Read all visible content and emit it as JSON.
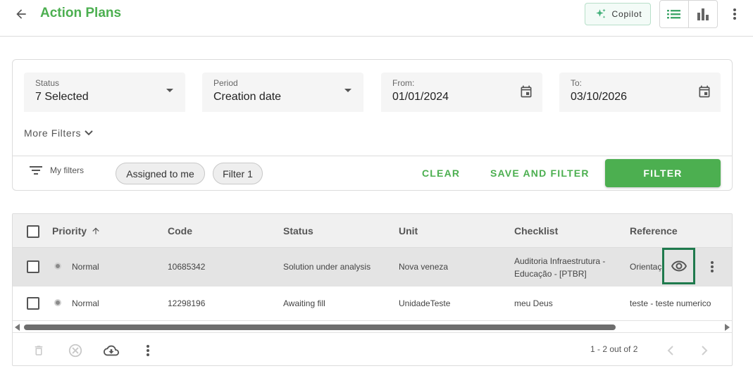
{
  "header": {
    "title": "Action Plans",
    "copilot_label": "Copilot"
  },
  "filters": {
    "status": {
      "label": "Status",
      "value": "7 Selected"
    },
    "period": {
      "label": "Period",
      "value": "Creation date"
    },
    "from": {
      "label": "From:",
      "value": "01/01/2024"
    },
    "to": {
      "label": "To:",
      "value": "03/10/2026"
    },
    "more_filters": "More Filters",
    "my_filters": "My filters",
    "chips": [
      "Assigned to me",
      "Filter 1"
    ],
    "clear_label": "CLEAR",
    "save_and_filter_label": "SAVE AND FILTER",
    "filter_label": "FILTER"
  },
  "table": {
    "columns": [
      "Priority",
      "Code",
      "Status",
      "Unit",
      "Checklist",
      "Reference"
    ],
    "rows": [
      {
        "priority": "Normal",
        "code": "10685342",
        "status": "Solution under analysis",
        "unit": "Nova veneza",
        "checklist_line1": "Auditoria Infraestrutura -",
        "checklist_line2": "Educação - [PTBR]",
        "reference": "Orientaç"
      },
      {
        "priority": "Normal",
        "code": "12298196",
        "status": "Awaiting fill",
        "unit": "UnidadeTeste",
        "checklist_line1": "meu Deus",
        "checklist_line2": "",
        "reference": "teste - teste numerico"
      }
    ],
    "pagination": "1 - 2 out of 2"
  },
  "colors": {
    "accent": "#4caf50",
    "highlight_border": "#1f7a4d"
  },
  "icons": [
    "back-arrow-icon",
    "sparkle-icon",
    "list-view-icon",
    "bar-chart-icon",
    "more-vert-icon",
    "chevron-down-icon",
    "calendar-icon",
    "filter-list-icon",
    "arrow-up-icon",
    "eye-icon",
    "trash-icon",
    "cancel-circle-icon",
    "cloud-download-icon",
    "chevron-left-icon",
    "chevron-right-icon"
  ]
}
